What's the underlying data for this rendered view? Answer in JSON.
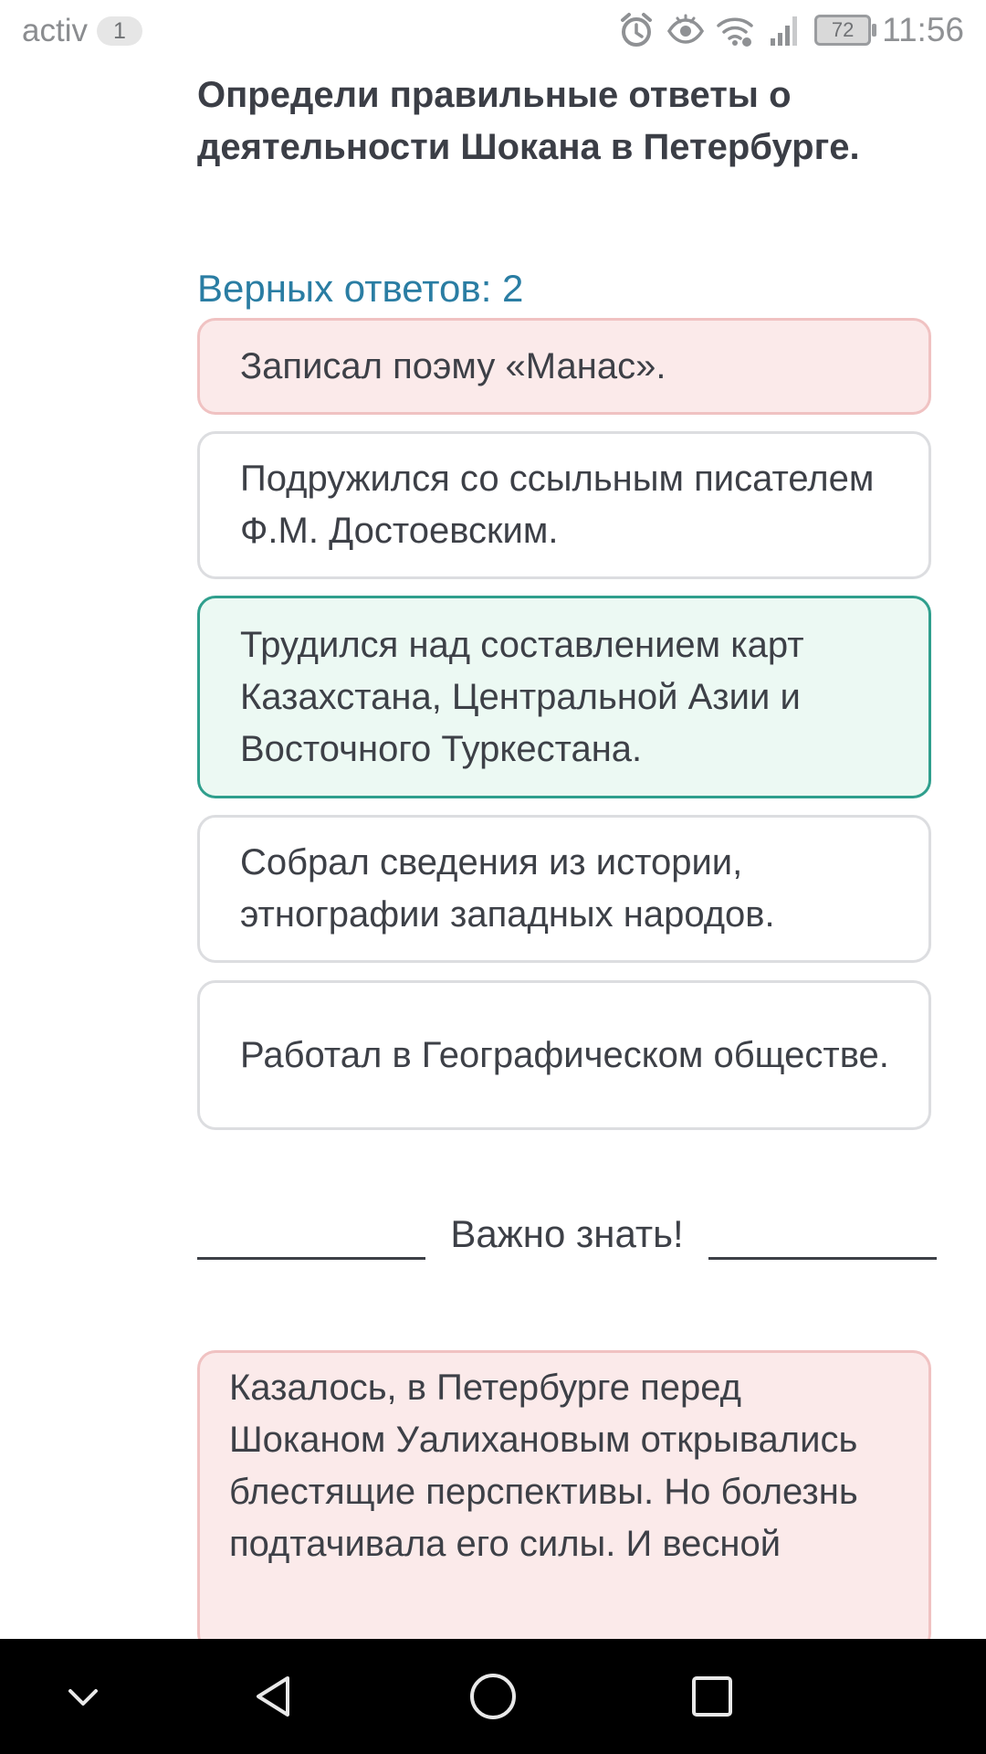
{
  "status": {
    "app": "activ",
    "badge": "1",
    "battery": "72",
    "time": "11:56",
    "icons": [
      "alarm-icon",
      "eye-icon",
      "wifi-icon",
      "signal-icon",
      "battery-icon"
    ]
  },
  "quiz": {
    "question": "Определи правильные ответы о деятельности Шокана в Петербурге.",
    "correct_count": "Верных ответов: 2",
    "options": [
      {
        "text": "Записал поэму «Манас».",
        "state": "wrong"
      },
      {
        "text": "Подружился со ссыльным писателем Ф.М. Достоевским.",
        "state": "neutral"
      },
      {
        "text": "Трудился над составлением карт Казахстана, Центральной Азии и Восточного Туркестана.",
        "state": "correct"
      },
      {
        "text": "Собрал сведения из истории, этнографии западных народов.",
        "state": "neutral"
      },
      {
        "text": "Работал в Географическом обществе.",
        "state": "neutral"
      }
    ]
  },
  "important": {
    "heading": "Важно знать!",
    "text": "Казалось, в Петербурге перед Шоканом Уалихановым открывались блестящие перспективы. Но болезнь подтачивала его силы. И весной"
  },
  "nav": {
    "icons": [
      "chevron-down-icon",
      "back-icon",
      "home-icon",
      "recents-icon"
    ]
  },
  "colors": {
    "accent": "#2a7da3",
    "wrong_bg": "#fbeaea",
    "correct_border": "#2f9f8d"
  }
}
